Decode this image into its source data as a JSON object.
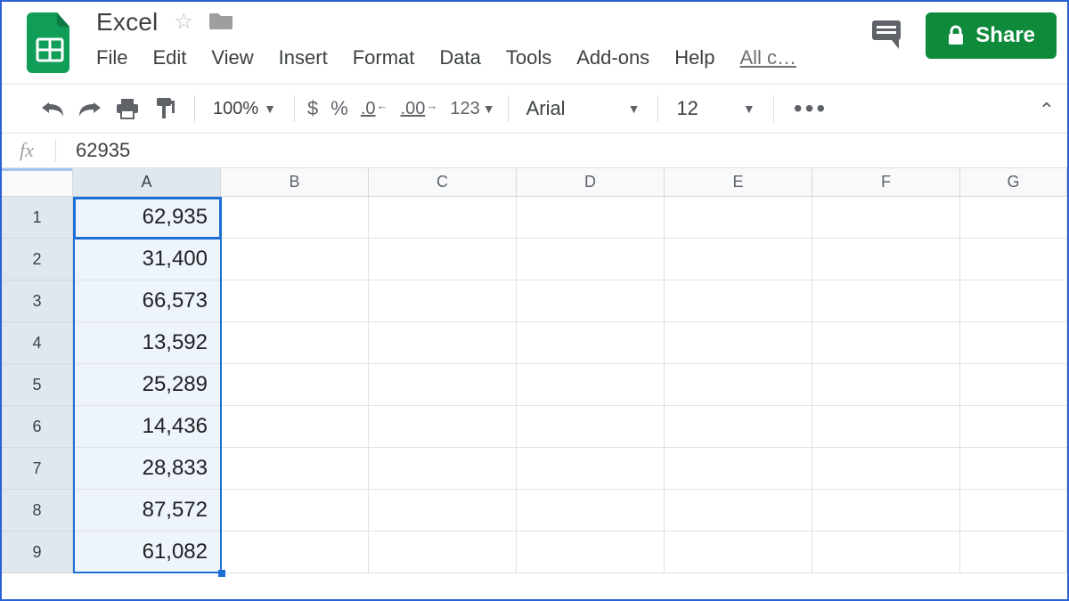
{
  "doc_title": "Excel",
  "menus": [
    "File",
    "Edit",
    "View",
    "Insert",
    "Format",
    "Data",
    "Tools",
    "Add-ons",
    "Help"
  ],
  "menu_overflow": "All c…",
  "share_label": "Share",
  "toolbar": {
    "zoom": "100%",
    "currency": "$",
    "percent": "%",
    "dec_less": ".0",
    "dec_more": ".00",
    "num_format": "123",
    "font": "Arial",
    "font_size": "12"
  },
  "formula_value": "62935",
  "columns": [
    "A",
    "B",
    "C",
    "D",
    "E",
    "F",
    "G"
  ],
  "rows": [
    {
      "n": "1",
      "a": "62,935"
    },
    {
      "n": "2",
      "a": "31,400"
    },
    {
      "n": "3",
      "a": "66,573"
    },
    {
      "n": "4",
      "a": "13,592"
    },
    {
      "n": "5",
      "a": "25,289"
    },
    {
      "n": "6",
      "a": "14,436"
    },
    {
      "n": "7",
      "a": "28,833"
    },
    {
      "n": "8",
      "a": "87,572"
    },
    {
      "n": "9",
      "a": "61,082"
    }
  ]
}
